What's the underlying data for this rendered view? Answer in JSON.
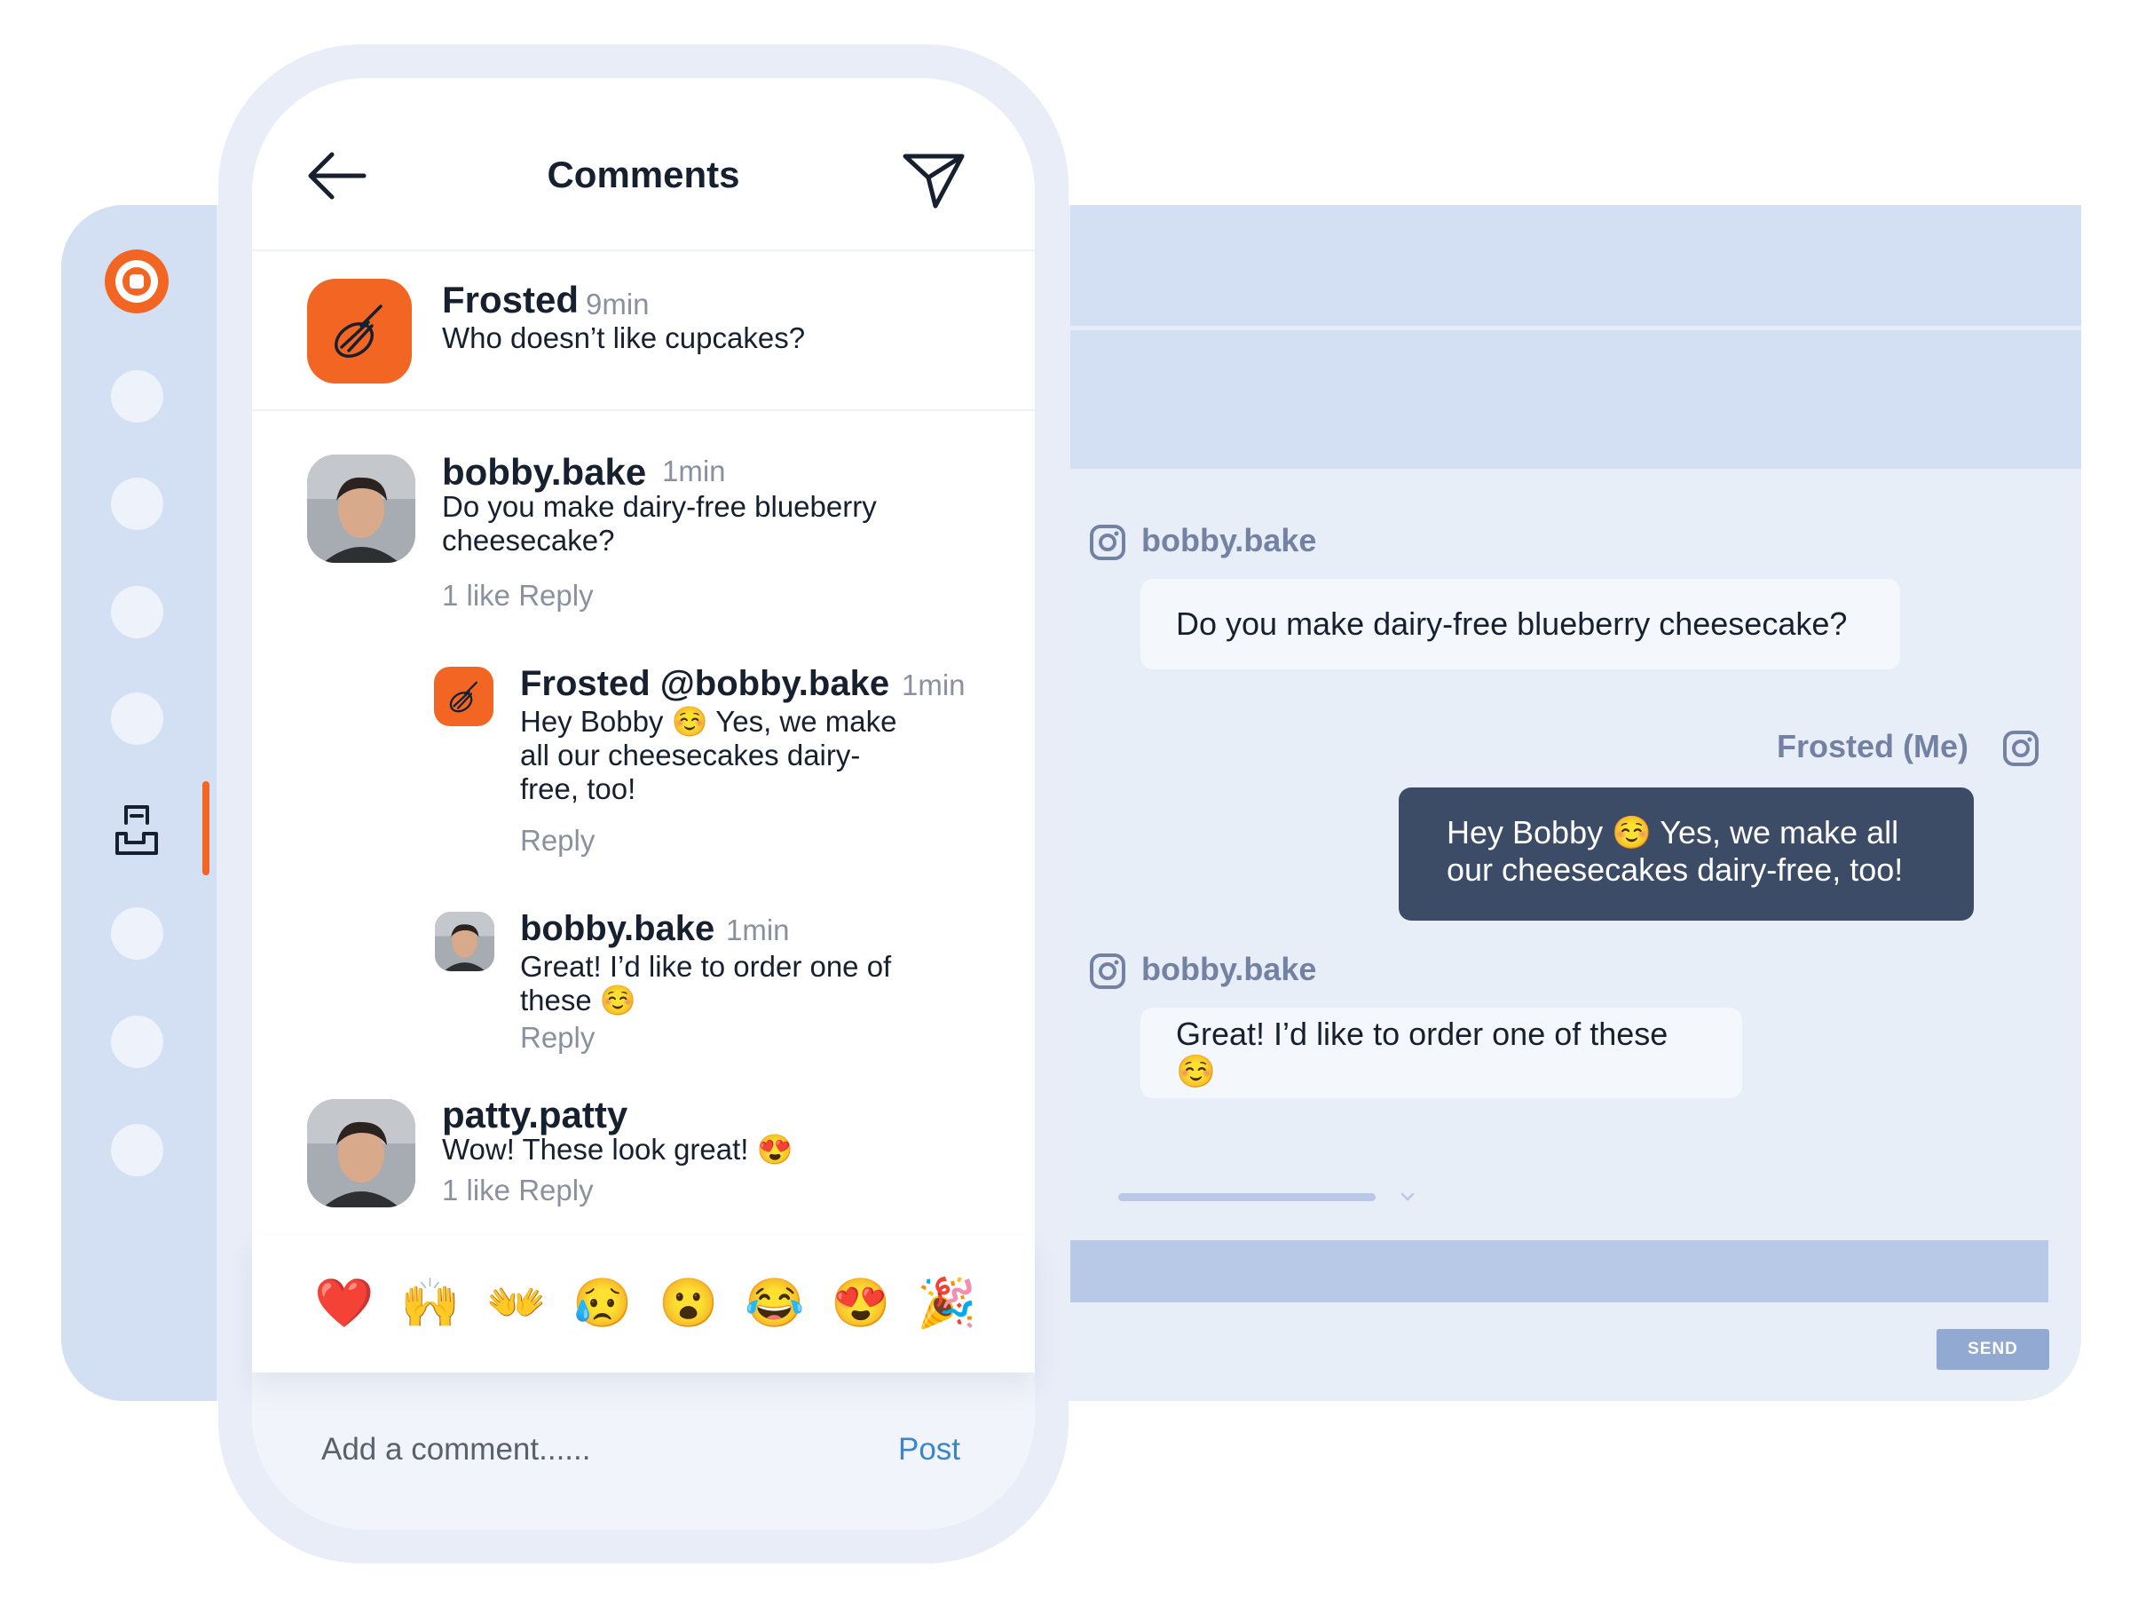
{
  "phone": {
    "title": "Comments",
    "post": {
      "user": "Frosted",
      "time": "9min",
      "text": "Who doesn’t like cupcakes?"
    },
    "comments": [
      {
        "user": "bobby.bake",
        "time": "1min",
        "text": "Do you make dairy-free blueberry cheesecake?",
        "meta": "1 like Reply"
      },
      {
        "user": "Frosted @bobby.bake",
        "time": "1min",
        "text": "Hey Bobby ☺️ Yes, we make all our cheesecakes dairy-free, too!",
        "meta": "Reply"
      },
      {
        "user": "bobby.bake",
        "time": "1min",
        "text": "Great! I’d like to order one of these ☺️",
        "meta": "Reply"
      },
      {
        "user": "patty.patty",
        "text": "Wow! These look great! 😍",
        "meta": "1 like Reply"
      }
    ],
    "emojis": [
      "❤️",
      "🙌",
      "👐",
      "😥",
      "😮",
      "😂",
      "😍",
      "🎉"
    ],
    "comment_placeholder": "Add a comment......",
    "post_label": "Post"
  },
  "chat": {
    "messages": [
      {
        "sender": "bobby.bake",
        "text": "Do you make dairy-free blueberry cheesecake?",
        "direction": "in"
      },
      {
        "sender": "Frosted (Me)",
        "text": "Hey Bobby ☺️ Yes, we make all our cheesecakes dairy-free, too!",
        "direction": "out"
      },
      {
        "sender": "bobby.bake",
        "text": "Great! I’d like to order one of these ☺️",
        "direction": "in"
      }
    ],
    "send_label": "SEND"
  },
  "colors": {
    "brand": "#f26522",
    "sidebar": "#d3dff3",
    "outgoing_bubble": "#3d4c66",
    "send_button": "#92a9d2",
    "link": "#3a86c9"
  }
}
